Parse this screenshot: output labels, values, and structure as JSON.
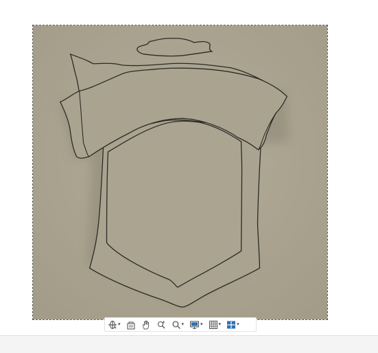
{
  "canvas": {
    "background_color": "#aba490",
    "outline_color": "#2a2a26",
    "object": "crest-shield-with-banner-outline"
  },
  "toolbar": {
    "tools": [
      {
        "name": "orbit",
        "icon": "orbit-icon",
        "has_dropdown": true
      },
      {
        "name": "look-at",
        "icon": "look-at-icon",
        "has_dropdown": false
      },
      {
        "name": "pan",
        "icon": "pan-hand-icon",
        "has_dropdown": false
      },
      {
        "name": "zoom",
        "icon": "zoom-icon",
        "has_dropdown": false
      },
      {
        "name": "fit",
        "icon": "zoom-window-icon",
        "has_dropdown": true
      },
      {
        "name": "display-settings",
        "icon": "display-icon",
        "has_dropdown": true
      },
      {
        "name": "grid-settings",
        "icon": "grid-icon",
        "has_dropdown": true
      },
      {
        "name": "viewports",
        "icon": "viewports-icon",
        "has_dropdown": true
      }
    ],
    "accent_color": "#2f6fb5"
  },
  "status_bar": {
    "background_color": "#f4f4f4"
  }
}
